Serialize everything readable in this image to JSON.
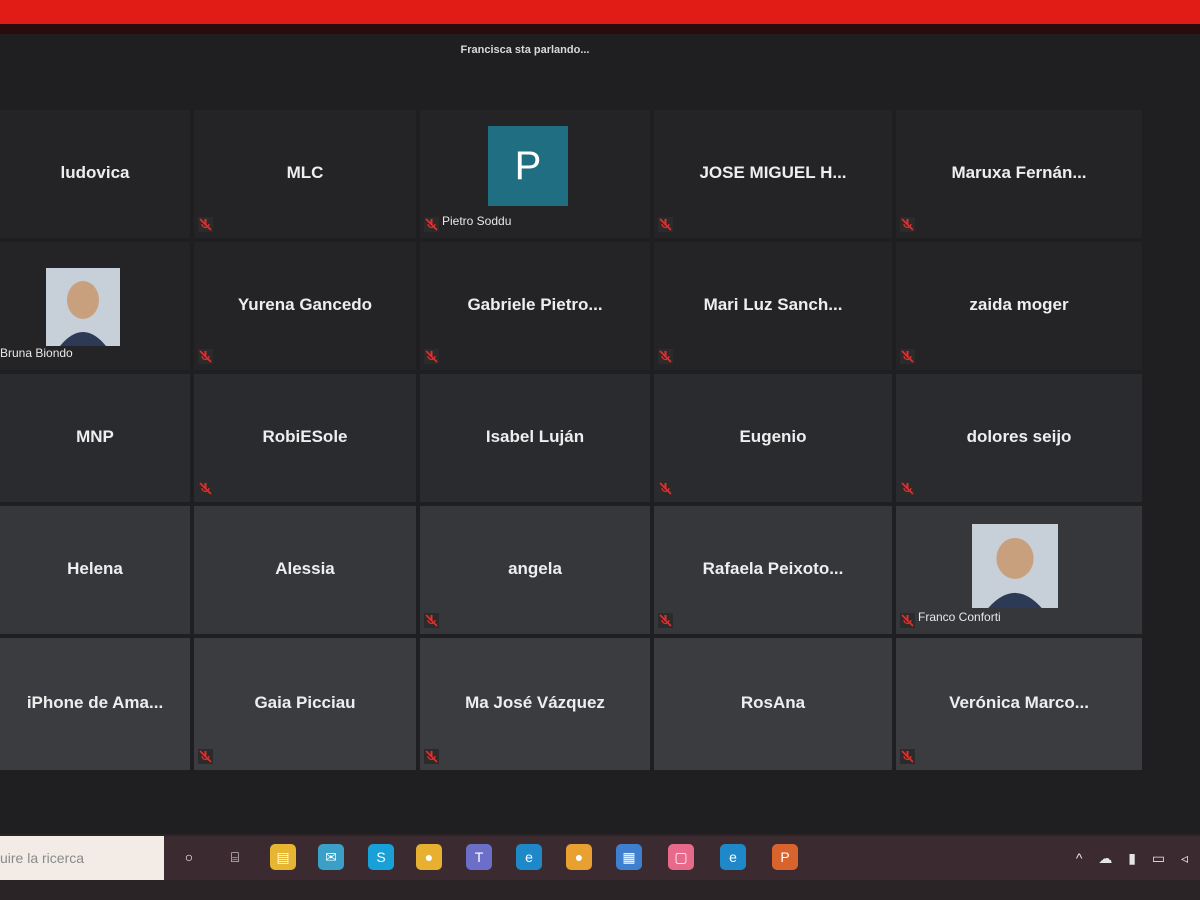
{
  "meeting": {
    "speaking_status": "Francisca sta parlando...",
    "tiles": [
      {
        "name": "ludovica",
        "muted": false,
        "row": 1
      },
      {
        "name": "MLC",
        "muted": true,
        "row": 1
      },
      {
        "name": "",
        "muted": true,
        "row": 1,
        "avatar_letter": "P",
        "label": "Pietro Soddu"
      },
      {
        "name": "JOSE MIGUEL H...",
        "muted": true,
        "row": 1
      },
      {
        "name": "Maruxa Fernán...",
        "muted": true,
        "row": 1
      },
      {
        "name": "",
        "muted": false,
        "row": 2,
        "photo": true,
        "label": "Bruna Biondo"
      },
      {
        "name": "Yurena Gancedo",
        "muted": true,
        "row": 2
      },
      {
        "name": "Gabriele Pietro...",
        "muted": true,
        "row": 2
      },
      {
        "name": "Mari Luz Sanch...",
        "muted": true,
        "row": 2
      },
      {
        "name": "zaida moger",
        "muted": true,
        "row": 2
      },
      {
        "name": "MNP",
        "muted": false,
        "row": 3
      },
      {
        "name": "RobiESole",
        "muted": true,
        "row": 3
      },
      {
        "name": "Isabel Luján",
        "muted": false,
        "row": 3
      },
      {
        "name": "Eugenio",
        "muted": true,
        "row": 3
      },
      {
        "name": "dolores seijo",
        "muted": true,
        "row": 3
      },
      {
        "name": "Helena",
        "muted": false,
        "row": 4
      },
      {
        "name": "Alessia",
        "muted": false,
        "row": 4
      },
      {
        "name": "angela",
        "muted": true,
        "row": 4
      },
      {
        "name": "Rafaela Peixoto...",
        "muted": true,
        "row": 4
      },
      {
        "name": "",
        "muted": true,
        "row": 4,
        "photo": true,
        "label": "Franco Conforti"
      },
      {
        "name": "iPhone de Ama...",
        "muted": false,
        "row": 5
      },
      {
        "name": "Gaia Picciau",
        "muted": true,
        "row": 5
      },
      {
        "name": "Ma José Vázquez",
        "muted": true,
        "row": 5
      },
      {
        "name": "RosAna",
        "muted": false,
        "row": 5
      },
      {
        "name": "Verónica Marco...",
        "muted": true,
        "row": 5
      }
    ]
  },
  "taskbar": {
    "search_placeholder": "uire la ricerca",
    "icons": [
      "cortana-icon",
      "task-view-icon",
      "file-explorer-icon",
      "mail-icon",
      "skype-icon",
      "chrome-icon",
      "teams-icon",
      "edge-icon",
      "chrome-icon-2",
      "app-icon",
      "calendar-icon",
      "edge-icon-2",
      "powerpoint-icon"
    ],
    "tray_glyphs": "^ ☁ ▮ ▭ ◃"
  },
  "colors": {
    "accent_red": "#e11c17",
    "avatar_teal": "#1f6e82",
    "mute_red": "#e03030"
  }
}
